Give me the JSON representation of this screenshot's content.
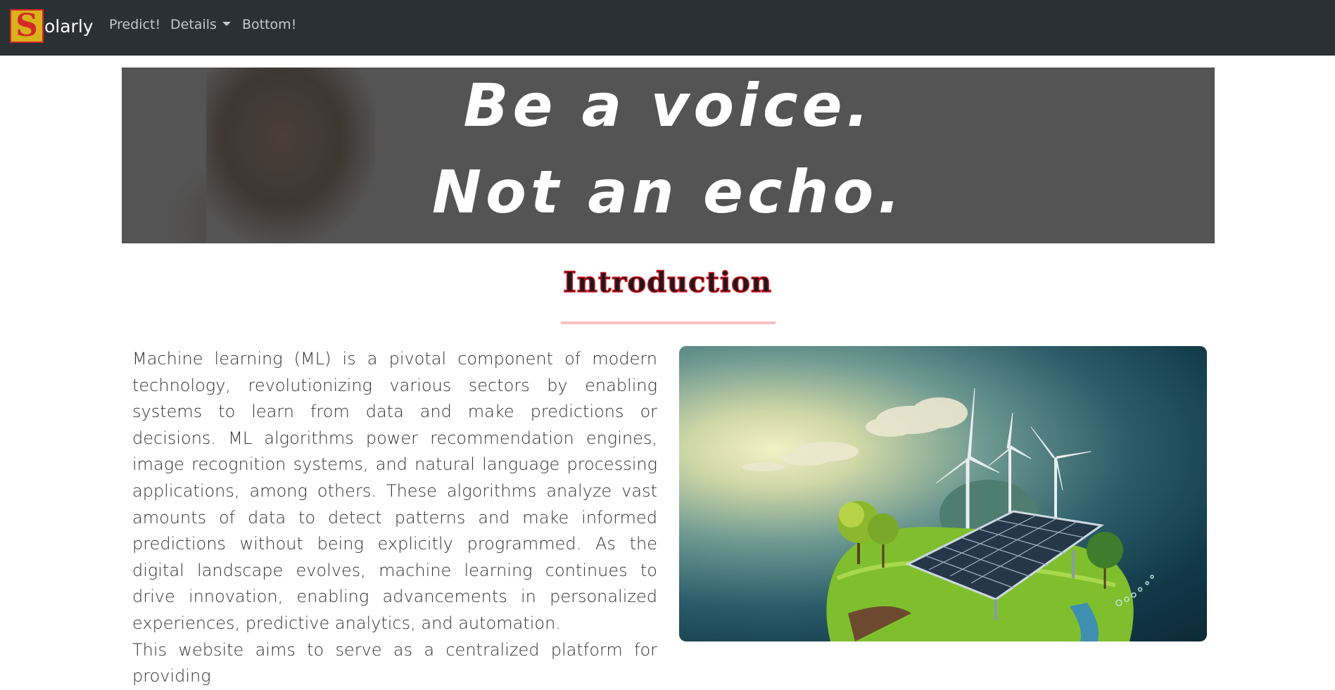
{
  "navbar": {
    "brand_initial": "S",
    "brand_rest": "olarly",
    "links": {
      "predict": "Predict!",
      "details": "Details",
      "bottom": "Bottom!"
    }
  },
  "banner": {
    "line1": "Be a voice.",
    "line2": "Not an echo."
  },
  "intro": {
    "title": "Introduction",
    "paragraph1": "Machine learning (ML) is a pivotal component of modern technology, revolutionizing various sectors by enabling systems to learn from data and make predictions or decisions. ML algorithms power recommendation engines, image recognition systems, and natural language processing applications, among others. These algorithms analyze vast amounts of data to detect patterns and make informed predictions without being explicitly programmed. As the digital landscape evolves, machine learning continues to drive innovation, enabling advancements in personalized experiences, predictive analytics, and automation.",
    "paragraph2": "This website aims to serve as a centralized platform for providing"
  },
  "colors": {
    "navbar_bg": "#2b3035",
    "title_outline": "#d01020",
    "title_rule": "#f7c1c7",
    "logo_bg": "#d9b21c",
    "logo_letter": "#d62828"
  },
  "icons": {
    "details_dropdown": "caret-down-icon"
  }
}
